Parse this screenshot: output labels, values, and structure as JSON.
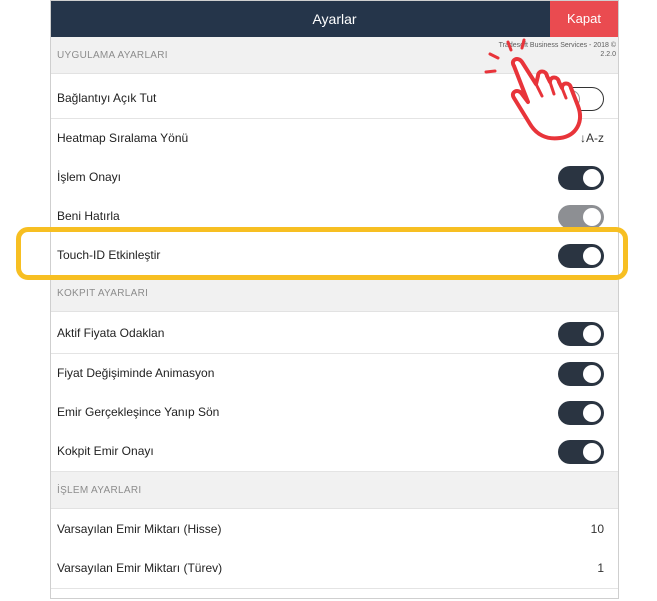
{
  "header": {
    "title": "Ayarlar",
    "close_label": "Kapat"
  },
  "version_text_line1": "Tradesoft Business Services - 2018 ©",
  "version_text_line2": "2.2.0",
  "sections": {
    "app": "UYGULAMA AYARLARI",
    "kokpit": "KOKPIT AYARLARI",
    "islem": "İŞLEM AYARLARI"
  },
  "rows": {
    "baglanti": "Bağlantıyı Açık Tut",
    "heatmap": "Heatmap Sıralama Yönü",
    "heatmap_value": "↓A-z",
    "islem_onayi": "İşlem Onayı",
    "beni_hatirla": "Beni Hatırla",
    "touch_id": "Touch-ID Etkinleştir",
    "aktif_fiyat": "Aktif Fiyata Odaklan",
    "fiyat_animasyon": "Fiyat Değişiminde Animasyon",
    "emir_yanip": "Emir Gerçekleşince Yanıp Sön",
    "kokpit_onay": "Kokpit Emir Onayı",
    "miktar_hisse": "Varsayılan Emir Miktarı (Hisse)",
    "miktar_hisse_value": "10",
    "miktar_turev": "Varsayılan Emir Miktarı (Türev)",
    "miktar_turev_value": "1"
  },
  "toggles": {
    "baglanti": "off",
    "islem_onayi": "on",
    "beni_hatirla": "on-disabled",
    "touch_id": "on",
    "aktif_fiyat": "on",
    "fiyat_animasyon": "on",
    "emir_yanip": "on",
    "kokpit_onay": "on"
  },
  "colors": {
    "header_bg": "#25354a",
    "close_bg": "#ea4b50",
    "toggle_on": "#2a3441",
    "highlight": "#f7bf22",
    "hand": "#e8343a"
  },
  "icons": {
    "hand": "tap-hand-icon"
  }
}
